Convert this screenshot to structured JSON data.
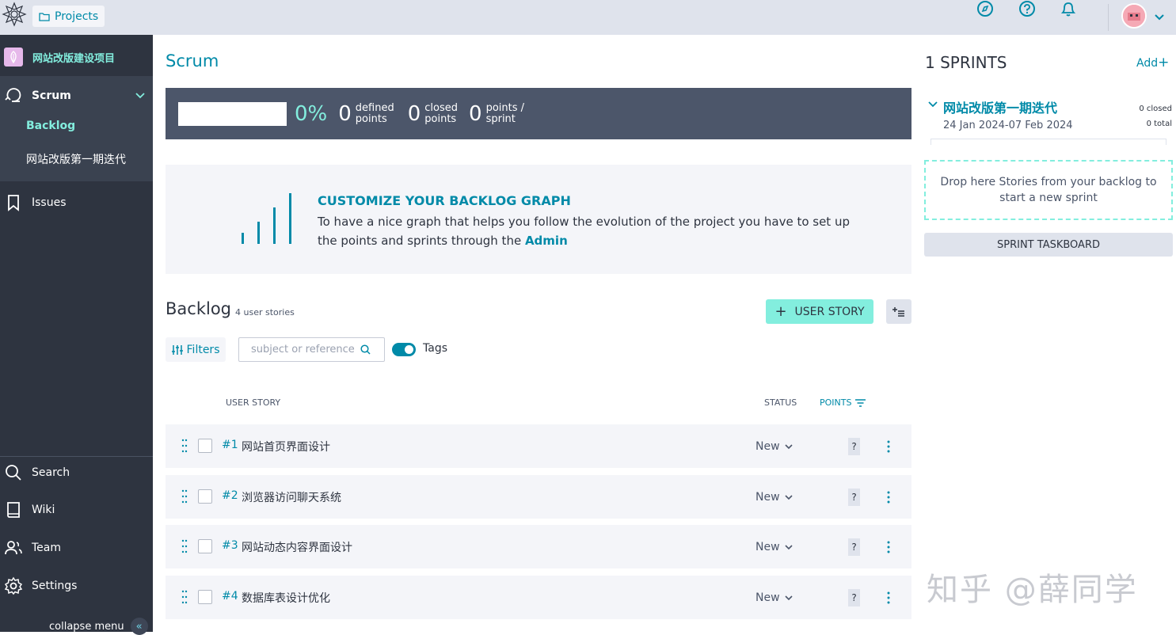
{
  "topbar": {
    "projects_label": "Projects"
  },
  "sidebar": {
    "project_name": "网站改版建设项目",
    "scrum_label": "Scrum",
    "backlog_label": "Backlog",
    "sprint_item_label": "网站改版第一期迭代",
    "issues_label": "Issues",
    "search_label": "Search",
    "wiki_label": "Wiki",
    "team_label": "Team",
    "settings_label": "Settings",
    "collapse_label": "collapse menu"
  },
  "main": {
    "title": "Scrum",
    "summary": {
      "progress_percent": "0%",
      "defined_points_value": "0",
      "defined_points_label_1": "defined",
      "defined_points_label_2": "points",
      "closed_points_value": "0",
      "closed_points_label_1": "closed",
      "closed_points_label_2": "points",
      "points_sprint_value": "0",
      "points_sprint_label_1": "points /",
      "points_sprint_label_2": "sprint"
    },
    "promo": {
      "title": "CUSTOMIZE YOUR BACKLOG GRAPH",
      "text": "To have a nice graph that helps you follow the evolution of the project you have to set up the points and sprints through the ",
      "link": "Admin"
    },
    "backlog": {
      "title": "Backlog",
      "count_label": "4 user stories",
      "add_story_label": "USER STORY",
      "filters_label": "Filters",
      "search_placeholder": "subject or reference",
      "tags_label": "Tags",
      "tags_enabled": true,
      "columns": {
        "user_story": "USER STORY",
        "status": "STATUS",
        "points": "POINTS"
      },
      "rows": [
        {
          "ref": "#1",
          "subject": "网站首页界面设计",
          "status": "New",
          "points": "?"
        },
        {
          "ref": "#2",
          "subject": "浏览器访问聊天系统",
          "status": "New",
          "points": "?"
        },
        {
          "ref": "#3",
          "subject": "网站动态内容界面设计",
          "status": "New",
          "points": "?"
        },
        {
          "ref": "#4",
          "subject": "数据库表设计优化",
          "status": "New",
          "points": "?"
        }
      ]
    }
  },
  "sprints": {
    "title": "1 SPRINTS",
    "add_label": "Add",
    "sprint": {
      "name": "网站改版第一期迭代",
      "dates": "24 Jan 2024-07 Feb 2024",
      "closed": "0 closed",
      "total": "0 total"
    },
    "dropzone_text": "Drop here Stories from your backlog to start a new sprint",
    "taskboard_label": "SPRINT TASKBOARD"
  },
  "watermark": "知乎 @薛同学",
  "colors": {
    "accent": "#008aa8",
    "mint": "#83eede",
    "sidebar_bg": "#2e3440",
    "topbar_bg": "#dfe3ec"
  }
}
